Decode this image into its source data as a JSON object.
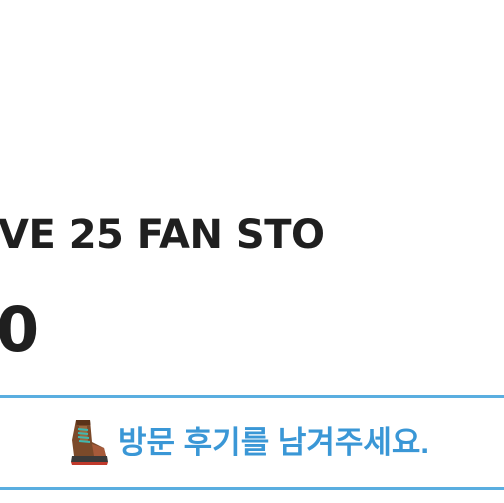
{
  "store": {
    "name_fragment": "VE 25 FAN STO",
    "value_fragment": "0"
  },
  "review_button": {
    "icon": "hiking-boot-icon",
    "label": "방문 후기를 남겨주세요."
  },
  "colors": {
    "text_primary": "#1f1f1f",
    "accent": "#3a97d6",
    "border": "#5aaee0"
  }
}
